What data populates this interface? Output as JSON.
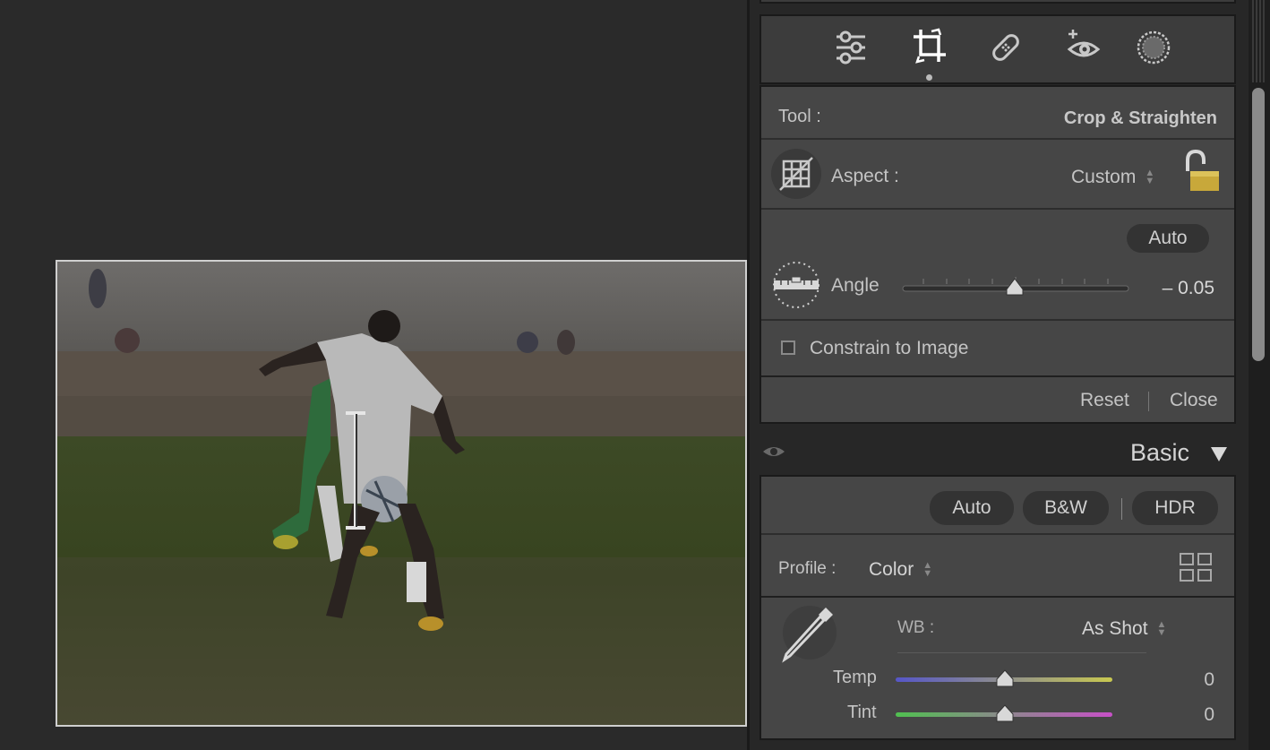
{
  "tool": {
    "label": "Tool :",
    "name": "Crop & Straighten",
    "aspect_label": "Aspect :",
    "aspect_value": "Custom",
    "auto_label": "Auto",
    "angle_label": "Angle",
    "angle_value": "– 0.05",
    "angle_slider_position": 0.5,
    "constrain_label": "Constrain to Image",
    "constrain_checked": false,
    "reset_label": "Reset",
    "close_label": "Close"
  },
  "toolbar_icons": [
    "sliders-icon",
    "crop-icon",
    "healing-bandage-icon",
    "red-eye-icon",
    "masking-icon"
  ],
  "basic": {
    "title": "Basic",
    "auto_label": "Auto",
    "bw_label": "B&W",
    "hdr_label": "HDR",
    "profile_label": "Profile :",
    "profile_value": "Color",
    "wb_label": "WB :",
    "wb_value": "As Shot",
    "temp_label": "Temp",
    "temp_value": "0",
    "temp_slider_position": 0.5,
    "tint_label": "Tint",
    "tint_value": "0",
    "tint_slider_position": 0.5
  },
  "colors": {
    "temp_gradient": [
      "#5656c8",
      "#c8c850"
    ],
    "tint_gradient": [
      "#50c050",
      "#c850c8"
    ],
    "lock_gold": "#c8a83a"
  }
}
